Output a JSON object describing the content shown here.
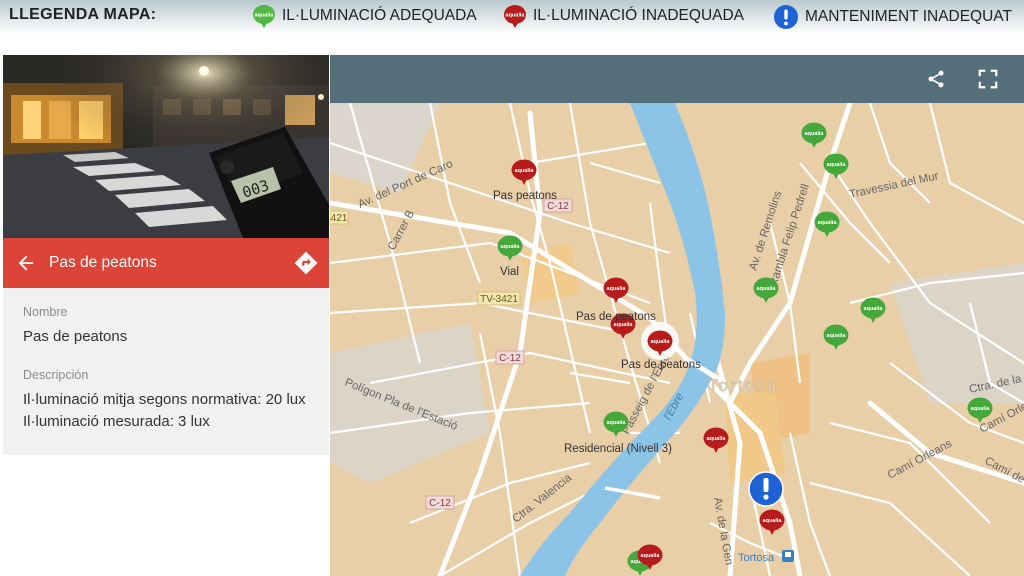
{
  "legend": {
    "title": "LLEGENDA MAPA:",
    "items": [
      {
        "label": "IL·LUMINACIÓ ADEQUADA",
        "color": "#52b843"
      },
      {
        "label": "IL·LUMINACIÓ INADEQUADA",
        "color": "#b71c1c"
      },
      {
        "label": "MANTENIMENT INADEQUAT",
        "color": "#1e63d6"
      }
    ],
    "marker_logo": "aqualia"
  },
  "panel": {
    "title": "Pas de peatons",
    "meter_reading": "003",
    "fields": [
      {
        "label": "Nombre",
        "values": [
          "Pas de peatons"
        ]
      },
      {
        "label": "Descripción",
        "values": [
          "Il·luminació mitja segons normativa: 20 lux",
          "Il·luminació mesurada: 3 lux"
        ]
      }
    ],
    "icons": {
      "back": "arrow-left-icon",
      "directions": "directions-icon"
    }
  },
  "map": {
    "toolbar_icons": [
      "share-icon",
      "fullscreen-icon"
    ],
    "place_labels": {
      "pas1": "Pas peatons",
      "vial": "Vial",
      "pas2": "Pas de peatons",
      "pas3": "Pas de peatons",
      "residencial": "Residencial (Nivell 3)",
      "tortosa": "Tortosa",
      "tortosa_station": "Tortosa"
    },
    "road_labels": {
      "c12a": "C-12",
      "c12b": "C-12",
      "c12c": "C-12",
      "tv3421": "TV-3421",
      "r421": "421",
      "port_caro": "Av. del Port de Caro",
      "carrer_b": "Carrer B",
      "poligon": "Polígon Pla de l'Estació",
      "cta_valencia": "Ctra. Valencia",
      "passeig": "Passeig de l'Ebre",
      "ebre": "l'Ebre",
      "remolins": "Av. de Remolins",
      "felip": "Rambla Felip Pedrell",
      "mur": "Travessia del Mur",
      "cami_orleans": "Camí Orleans",
      "cami_orle2": "Camí Orle",
      "cami_la": "Camí de la",
      "ctra_la": "Ctra. de la",
      "av_gen": "Av. de la Gen"
    }
  }
}
